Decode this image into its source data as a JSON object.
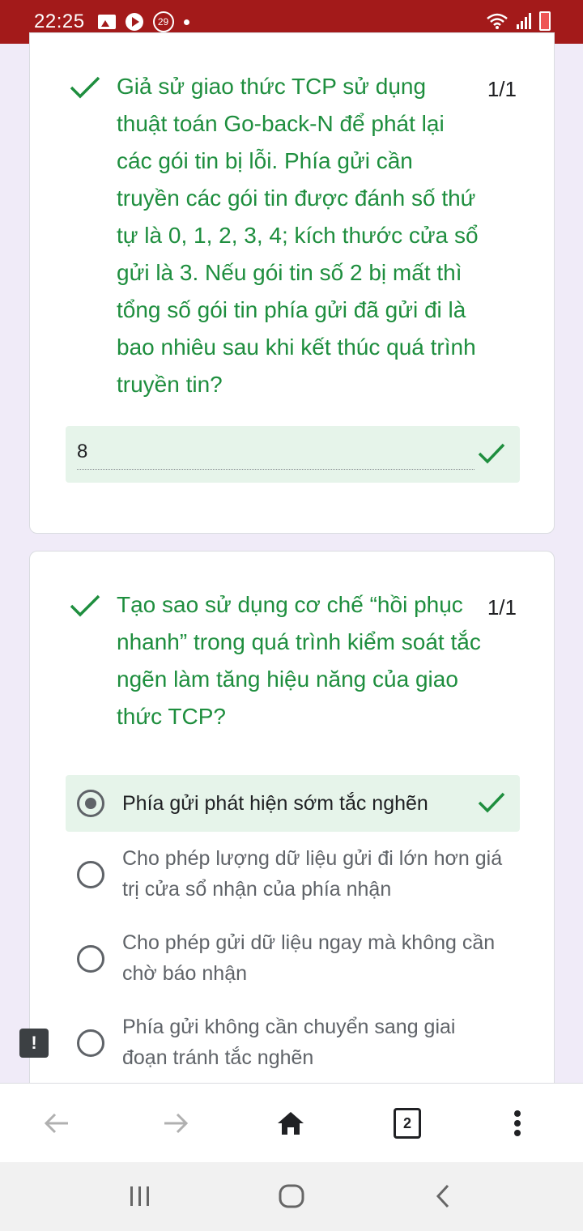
{
  "status_bar": {
    "time": "22:25",
    "notification_count": "29"
  },
  "question1": {
    "text": "Giả sử giao thức TCP sử dụng thuật toán Go-back-N để phát lại các gói tin bị lỗi. Phía gửi cần truyền các gói tin được đánh số thứ tự là 0, 1, 2, 3, 4; kích thước cửa sổ gửi là 3. Nếu gói tin số 2 bị mất thì tổng số gói tin phía gửi đã gửi đi là bao nhiêu sau khi kết thúc quá trình truyền tin?",
    "score": "1/1",
    "answer": "8"
  },
  "question2": {
    "text": "Tạo sao sử dụng cơ chế “hồi phục nhanh” trong quá trình kiểm soát tắc ngẽn làm tăng hiệu năng của giao thức TCP?",
    "score": "1/1",
    "options": [
      {
        "label": "Phía gửi phát hiện sớm tắc nghẽn",
        "selected": true
      },
      {
        "label": "Cho phép lượng dữ liệu gửi đi lớn hơn giá trị cửa sổ nhận của phía nhận",
        "selected": false
      },
      {
        "label": "Cho phép gửi dữ liệu ngay mà không cần chờ báo nhận",
        "selected": false
      },
      {
        "label": "Phía gửi không cần chuyển sang giai đoạn tránh tắc nghẽn",
        "selected": false
      }
    ]
  },
  "report_button": "!",
  "browser": {
    "tab_count": "2"
  },
  "colors": {
    "status_bar": "#a31a1a",
    "correct_green": "#1e8e3e",
    "correct_bg": "#e6f4ea",
    "page_bg": "#f0ebf8"
  }
}
